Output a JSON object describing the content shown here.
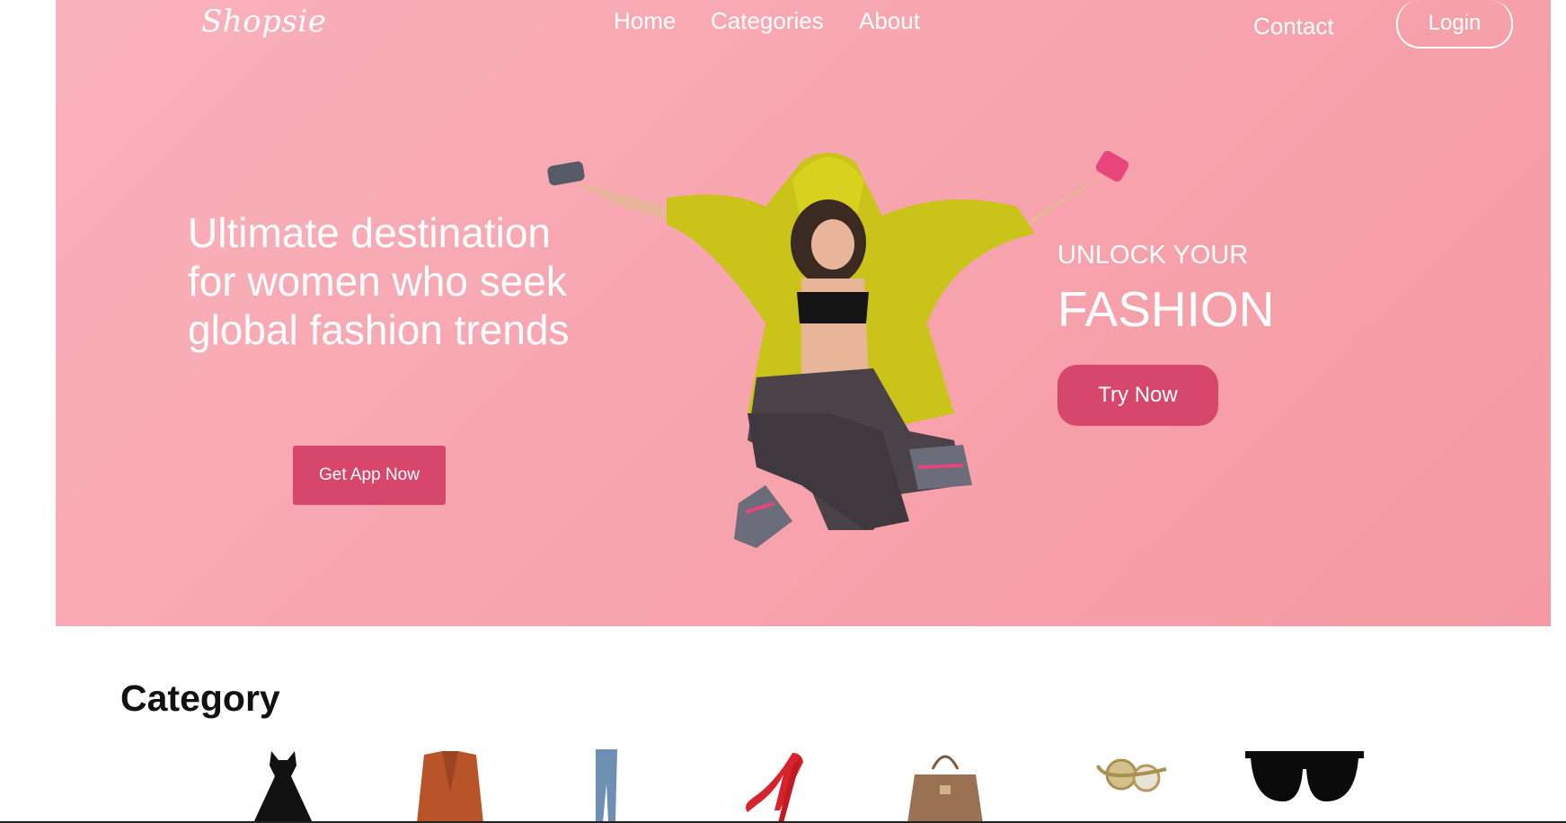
{
  "nav": {
    "logo": "Shopsie",
    "home": "Home",
    "categories": "Categories",
    "about": "About",
    "contact": "Contact",
    "login": "Login"
  },
  "hero": {
    "headline": "Ultimate destination for women who seek global fashion trends",
    "get_app": "Get App Now",
    "unlock": "UNLOCK YOUR",
    "fashion": "FASHION",
    "try_now": "Try Now"
  },
  "category": {
    "title": "Category",
    "items": [
      "dress-icon",
      "cardigan-icon",
      "jeans-icon",
      "heels-icon",
      "handbag-icon",
      "watch-icon",
      "sunglasses-icon"
    ]
  },
  "colors": {
    "hero_bg": "#f7a3ad",
    "accent": "#d6476b"
  }
}
